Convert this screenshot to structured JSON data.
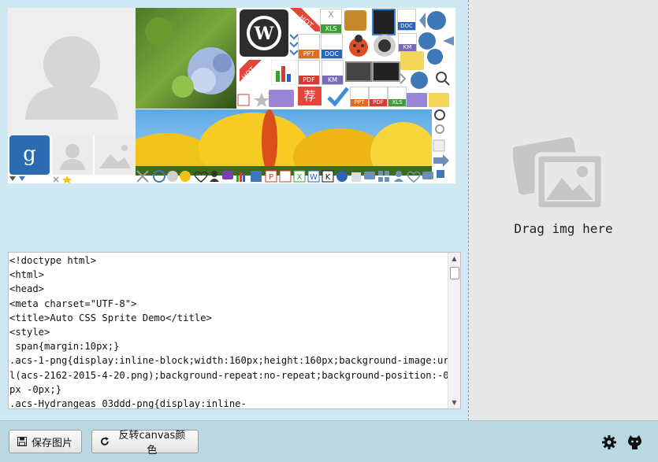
{
  "dropzone": {
    "text": "Drag img here",
    "icon": "image-placeholder-icon"
  },
  "sprite_preview": {
    "badges": {
      "hot1": "HOT",
      "hot2": "HOT",
      "tui": "荐",
      "g": "g",
      "w": "W",
      "k": "K",
      "x": "X",
      "p": "P"
    },
    "tiles": [
      {
        "label": "XLS",
        "color": "#3f9e3a"
      },
      {
        "label": "DOC",
        "color": "#2b64b8"
      },
      {
        "label": "PPT",
        "color": "#e36b1e"
      },
      {
        "label": "DOC",
        "color": "#2b64b8"
      },
      {
        "label": "KM",
        "color": "#7a6bb5"
      },
      {
        "label": "PDF",
        "color": "#d33b33"
      },
      {
        "label": "KM",
        "color": "#7a6bb5"
      },
      {
        "label": "PPT",
        "color": "#e36b1e"
      },
      {
        "label": "PDF",
        "color": "#d33b33"
      },
      {
        "label": "XLS",
        "color": "#3f9e3a"
      }
    ]
  },
  "code": {
    "text": "<!doctype html>\n<html>\n<head>\n<meta charset=\"UTF-8\">\n<title>Auto CSS Sprite Demo</title>\n<style>\n span{margin:10px;}\n.acs-1-png{display:inline-block;width:160px;height:160px;background-image:url(acs-2162-2015-4-20.png);background-repeat:no-repeat;background-position:-0px -0px;}\n.acs-Hydrangeas_03ddd-png{display:inline-"
  },
  "buttons": {
    "save_label": "保存图片",
    "invert_label": "反转canvas颜色"
  },
  "colors": {
    "background": "#cfe8f1",
    "panel": "#e8e8e8",
    "bottom_bar": "#b9d8e2"
  }
}
